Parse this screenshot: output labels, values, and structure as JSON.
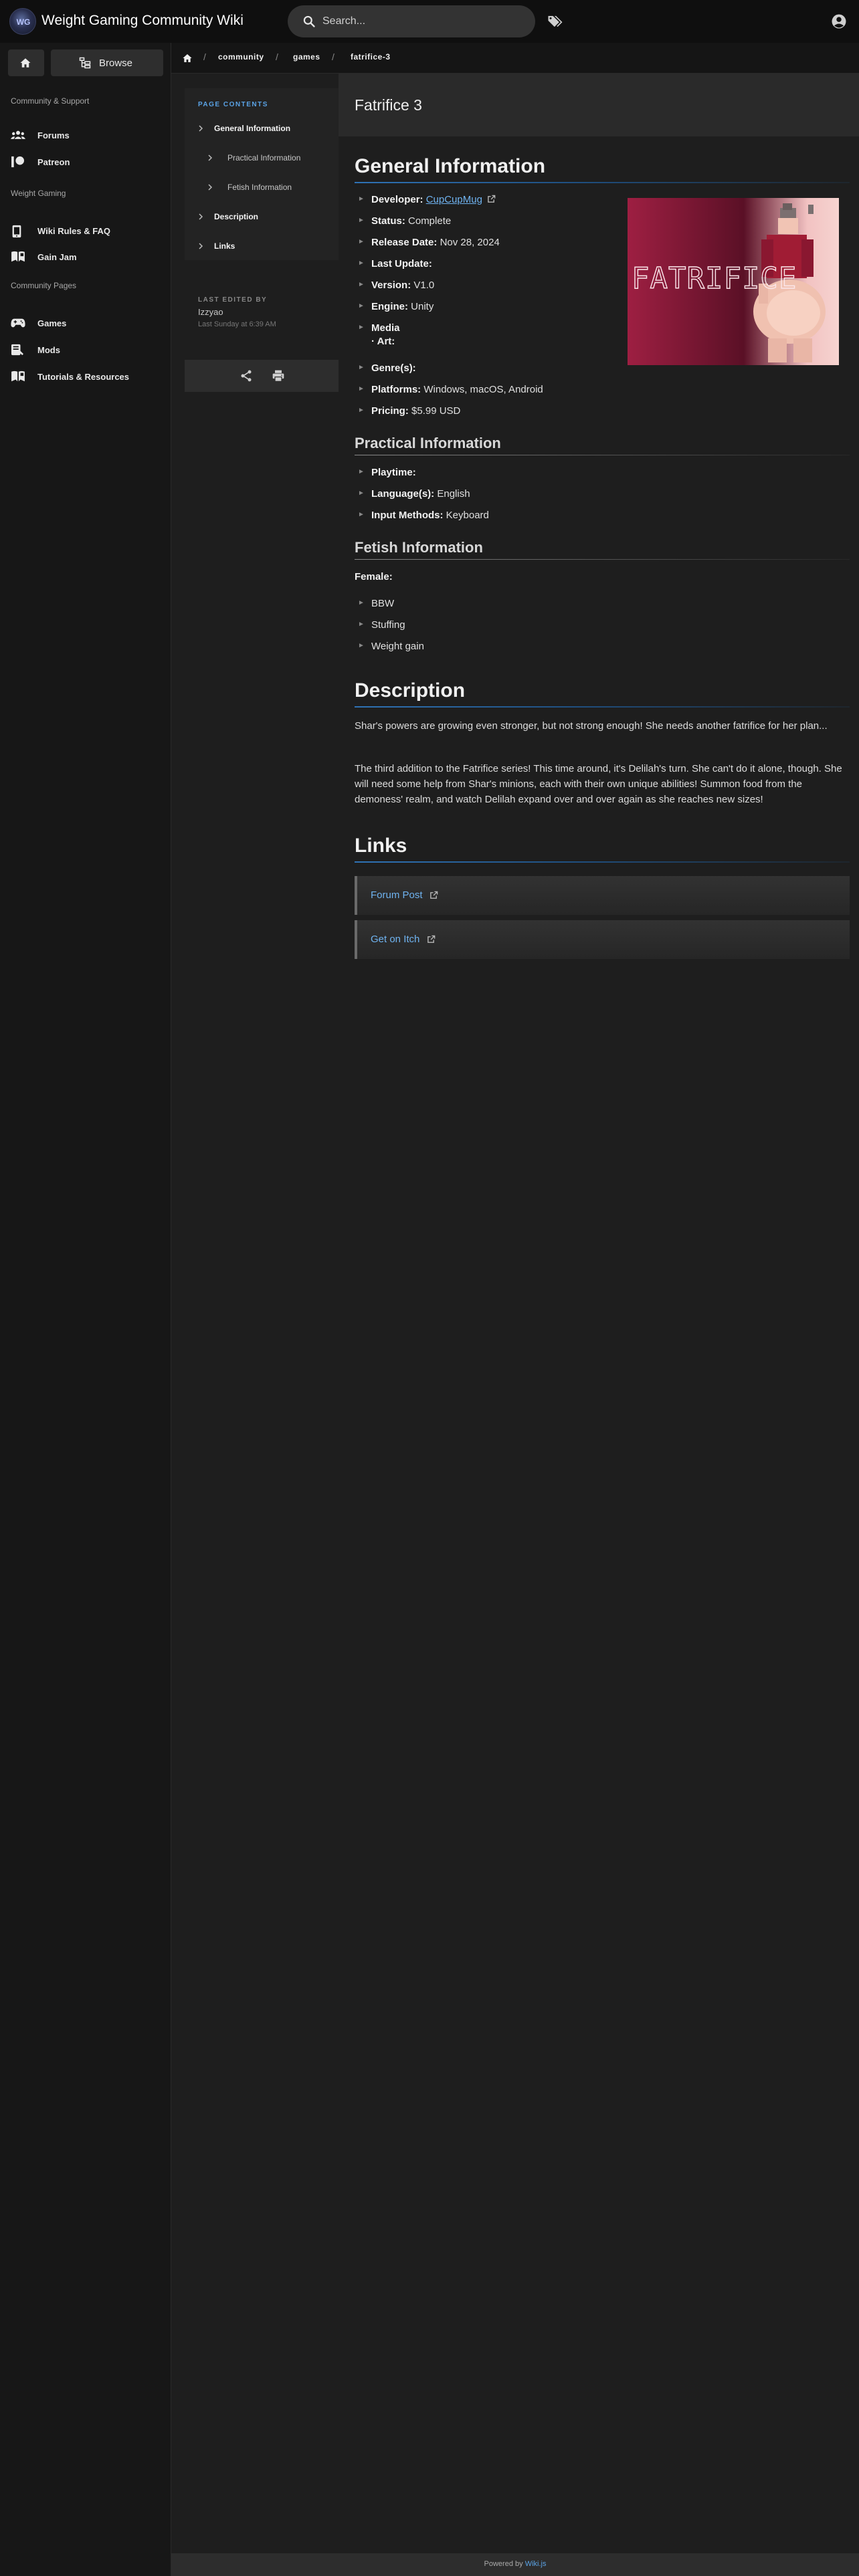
{
  "header": {
    "logo_letters": "WG",
    "site_title": "Weight Gaming Community Wiki",
    "search_placeholder": "Search..."
  },
  "sidebar": {
    "home_icon": "home-icon",
    "browse_label": "Browse",
    "sections": [
      {
        "header": "Community & Support",
        "items": [
          {
            "label": "Forums",
            "icon": "users-icon"
          },
          {
            "label": "Patreon",
            "icon": "patreon-icon"
          }
        ]
      },
      {
        "header": "Weight Gaming",
        "items": [
          {
            "label": "Wiki Rules & FAQ",
            "icon": "phone-icon"
          },
          {
            "label": "Gain Jam",
            "icon": "book-icon"
          }
        ]
      },
      {
        "header": "Community Pages",
        "items": [
          {
            "label": "Games",
            "icon": "gamepad-icon"
          },
          {
            "label": "Mods",
            "icon": "mods-icon"
          },
          {
            "label": "Tutorials & Resources",
            "icon": "book-icon"
          }
        ]
      }
    ]
  },
  "breadcrumb": [
    "community",
    "games",
    "fatrifice-3"
  ],
  "page": {
    "title": "Fatrifice 3"
  },
  "toc": {
    "header": "PAGE CONTENTS",
    "items": [
      {
        "label": "General Information",
        "level": 1
      },
      {
        "label": "Practical Information",
        "level": 2
      },
      {
        "label": "Fetish Information",
        "level": 2
      },
      {
        "label": "Description",
        "level": 1
      },
      {
        "label": "Links",
        "level": 1
      }
    ]
  },
  "last_edited": {
    "header": "LAST EDITED BY",
    "user": "Izzyao",
    "date": "Last Sunday at 6:39 AM"
  },
  "content": {
    "general": {
      "heading": "General Information",
      "developer_label": "Developer:",
      "developer_value": "CupCupMug",
      "status_label": "Status:",
      "status_value": "Complete",
      "release_label": "Release Date:",
      "release_value": "Nov 28, 2024",
      "last_update_label": "Last Update:",
      "version_label": "Version:",
      "version_value": "V1.0",
      "engine_label": "Engine:",
      "engine_value": "Unity",
      "media_label": "Media",
      "art_label": "· Art:",
      "genres_label": "Genre(s):",
      "platforms_label": "Platforms:",
      "platforms_value": "Windows, macOS, Android",
      "pricing_label": "Pricing:",
      "pricing_value": "$5.99 USD",
      "cover_text": "FATRIFICE"
    },
    "practical": {
      "heading": "Practical Information",
      "playtime_label": "Playtime:",
      "language_label": "Language(s):",
      "language_value": "English",
      "input_label": "Input Methods:",
      "input_value": "Keyboard"
    },
    "fetish": {
      "heading": "Fetish Information",
      "female_label": "Female:",
      "items": [
        "BBW",
        "Stuffing",
        "Weight gain"
      ]
    },
    "description": {
      "heading": "Description",
      "paragraphs": [
        "Shar's powers are growing even stronger, but not strong enough! She needs another fatrifice for her plan...",
        "The third addition to the Fatrifice series! This time around, it's Delilah's turn. She can't do it alone, though. She will need some help from Shar's minions, each with their own unique abilities! Summon food from the demoness' realm, and watch Delilah expand over and over again as she reaches new sizes!"
      ]
    },
    "links": {
      "heading": "Links",
      "items": [
        "Forum Post",
        "Get on Itch"
      ]
    }
  },
  "footer": {
    "prefix": "Powered by",
    "link": "Wiki.js"
  },
  "colors": {
    "accent": "#5aa3e6",
    "link": "#6fb3f0",
    "background": "#1e1e1e"
  }
}
